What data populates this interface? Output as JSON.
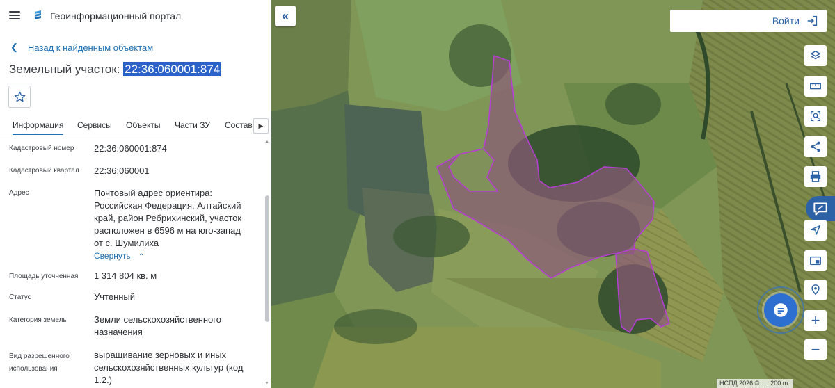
{
  "header": {
    "portal_title": "Геоинформационный портал"
  },
  "back_link": "Назад к найденным объектам",
  "object": {
    "title_prefix": "Земельный участок:",
    "cadastral_number": "22:36:060001:874"
  },
  "tabs": [
    {
      "label": "Информация",
      "active": true
    },
    {
      "label": "Сервисы"
    },
    {
      "label": "Объекты"
    },
    {
      "label": "Части ЗУ"
    },
    {
      "label": "Состав"
    }
  ],
  "info": {
    "cadastral_number": {
      "label": "Кадастровый номер",
      "value": "22:36:060001:874"
    },
    "cadastral_block": {
      "label": "Кадастровый квартал",
      "value": "22:36:060001"
    },
    "address": {
      "label": "Адрес",
      "lines": [
        "Почтовый адрес ориентира:",
        "Российская Федерация, Алтайский",
        "край, район Ребрихинский, участок",
        "расположен в 6596 м на юго-запад",
        "от с. Шумилиха"
      ],
      "collapse_label": "Свернуть"
    },
    "area": {
      "label": "Площадь уточненная",
      "value": "1 314 804 кв. м"
    },
    "status": {
      "label": "Статус",
      "value": "Учтенный"
    },
    "land_category": {
      "label": "Категория земель",
      "lines": [
        "Земли сельскохозяйственного",
        "назначения"
      ]
    },
    "permitted_use": {
      "label_lines": [
        "Вид разрешенного",
        "использования"
      ],
      "lines": [
        "выращивание зерновых и иных",
        "сельскохозяйственных культур (код",
        "1.2.)"
      ]
    }
  },
  "map": {
    "login_label": "Войти",
    "attribution": "НСПД 2026 ©",
    "scale_label": "200 m",
    "parcel_fill": "#8a5a78",
    "parcel_stroke": "#b43fd1",
    "accent": "#2d63a6"
  },
  "icons": {
    "menu": "hamburger-icon",
    "logo": "portal-logo-icon",
    "back": "chevron-left-icon",
    "favorite": "star-icon",
    "tabs_next": "triangle-right-icon",
    "collapse": "double-chevron-left-icon",
    "login": "login-icon",
    "tools": [
      "layers-icon",
      "ruler-icon",
      "select-area-icon",
      "share-icon",
      "print-icon",
      "chat-bubble-icon",
      "navigation-icon",
      "picture-in-picture-icon",
      "location-pin-icon",
      "zoom-in-icon",
      "zoom-out-icon"
    ]
  }
}
